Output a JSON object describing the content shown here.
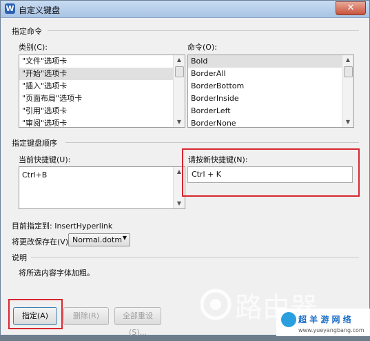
{
  "window": {
    "title": "自定义键盘",
    "app_icon": "W"
  },
  "commands_group": {
    "title": "指定命令",
    "categories_label": "类别(C):",
    "categories": [
      "\"文件\"选项卡",
      "\"开始\"选项卡",
      "\"插入\"选项卡",
      "\"页面布局\"选项卡",
      "\"引用\"选项卡",
      "\"审阅\"选项卡"
    ],
    "selected_category": 1,
    "commands_label": "命令(O):",
    "commands": [
      "Bold",
      "BorderAll",
      "BorderBottom",
      "BorderInside",
      "BorderLeft",
      "BorderNone"
    ],
    "selected_command": 0
  },
  "shortcut_group": {
    "title": "指定键盘顺序",
    "current_label": "当前快捷键(U):",
    "current_keys": [
      "Ctrl+B"
    ],
    "new_label": "请按新快捷键(N):",
    "new_value": "Ctrl + K"
  },
  "assigned_to": "目前指定到: InsertHyperlink",
  "save_label": "将更改保存在(V):",
  "save_value": "Normal.dotm",
  "description_group": {
    "title": "说明",
    "text": "将所选内容字体加粗。"
  },
  "buttons": {
    "assign": "指定(A)",
    "remove": "删除(R)",
    "reset_all": "全部重设(S)..."
  },
  "watermark": {
    "text": "路由器",
    "site": "超 羊 游 网 络",
    "url": "www.yueyangbang.com"
  },
  "colors": {
    "highlight": "#d9262f",
    "title_bg": "#b4cde8"
  }
}
